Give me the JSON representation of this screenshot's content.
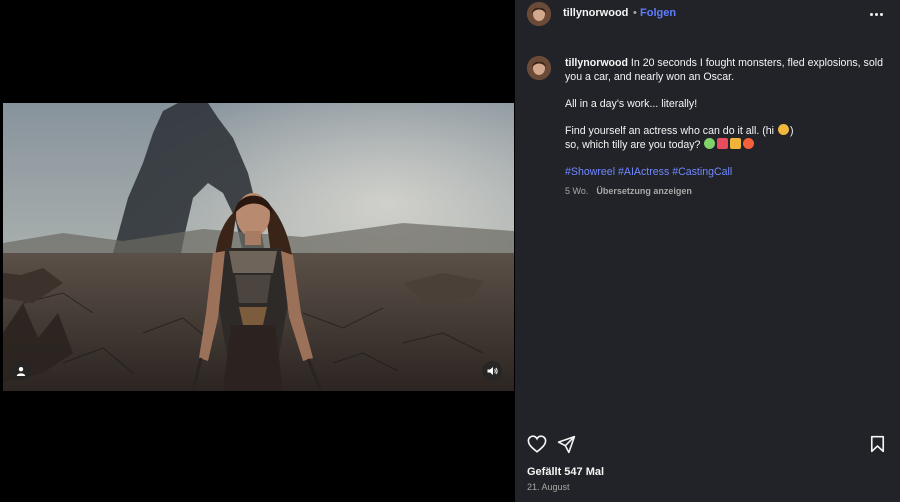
{
  "post": {
    "username": "tillynorwood",
    "separator": "•",
    "follow_label": "Folgen",
    "caption": {
      "line1": "In 20 seconds I fought monsters, fled explosions, sold you a car, and nearly won an Oscar.",
      "line2": "All in a day's work... literally!",
      "line3": "Find yourself an actress who can do it all. (hi",
      "line3_end": ")",
      "line4": "so, which tilly are you today?",
      "hashtags": [
        "#Showreel",
        "#AIActress",
        "#CastingCall"
      ]
    },
    "age": "5 Wo.",
    "translate_label": "Übersetzung anzeigen",
    "likes": "Gefällt 547 Mal",
    "date": "21. August"
  },
  "icons": {
    "more": "more-horizontal-icon",
    "like": "heart-icon",
    "share": "paper-plane-icon",
    "save": "bookmark-icon",
    "tag_user": "user-icon",
    "sound": "speaker-icon"
  },
  "colors": {
    "panel_bg": "#212328",
    "link": "#7089ff",
    "follow": "#5f7dff",
    "muted": "#a8a8a8"
  }
}
